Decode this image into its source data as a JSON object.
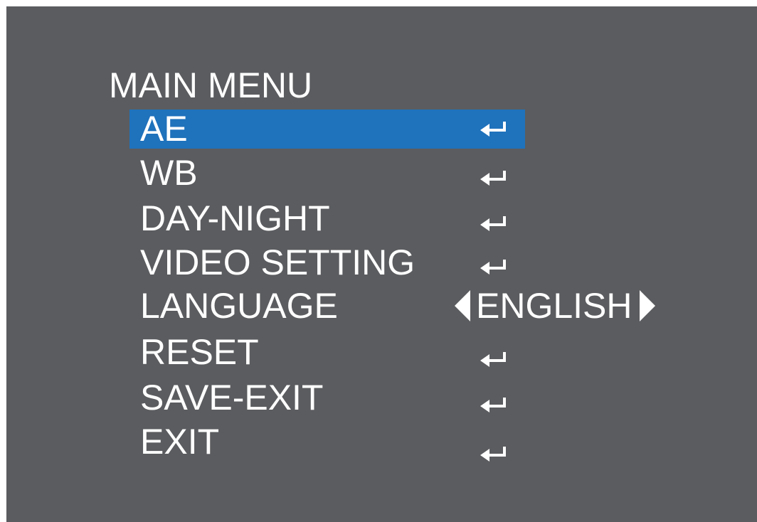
{
  "menu": {
    "title": "MAIN MENU",
    "enter_icon": "enter-return-icon",
    "selected_bg": "#1f72bc",
    "screen_bg": "#5b5c5f",
    "items": [
      {
        "label": "AE"
      },
      {
        "label": "WB"
      },
      {
        "label": "DAY-NIGHT"
      },
      {
        "label": "VIDEO SETTING"
      },
      {
        "label": "LANGUAGE",
        "value": "ENGLISH"
      },
      {
        "label": "RESET"
      },
      {
        "label": "SAVE-EXIT"
      },
      {
        "label": "EXIT"
      }
    ]
  }
}
